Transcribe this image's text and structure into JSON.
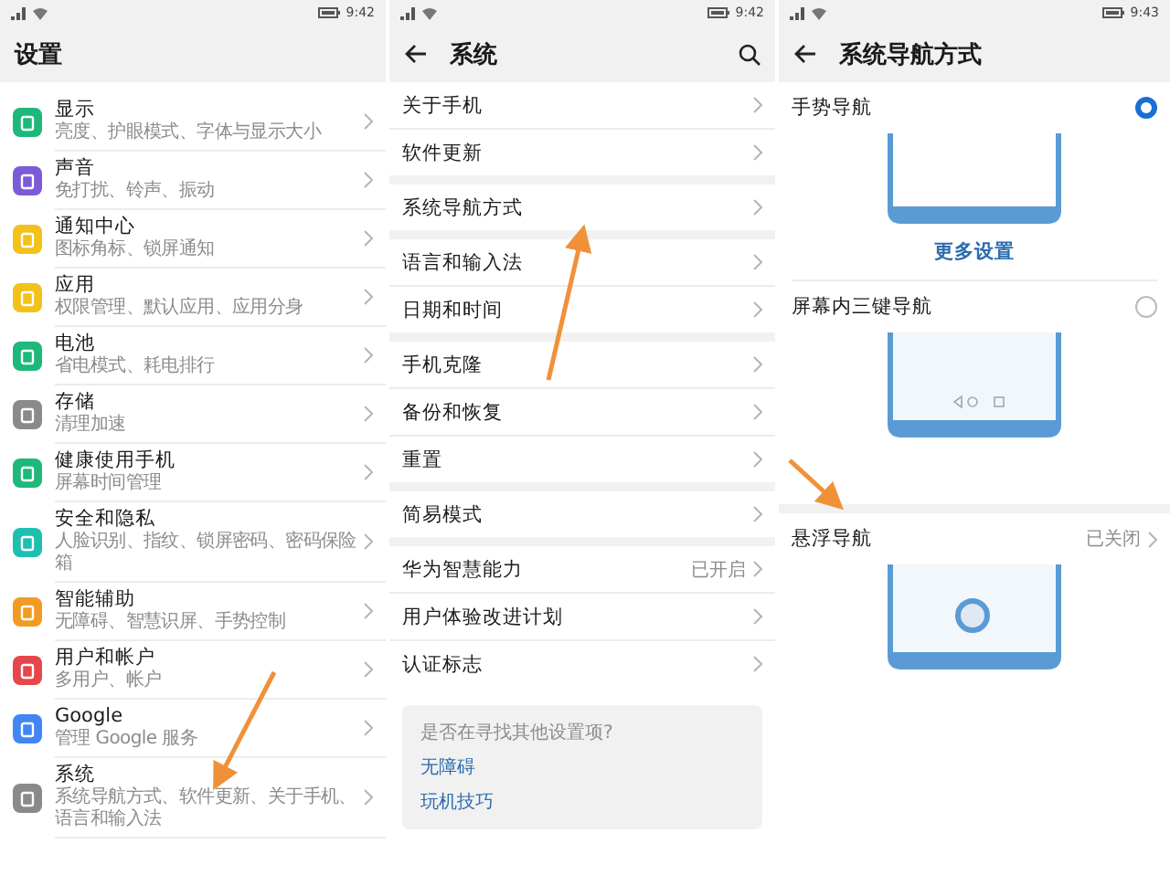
{
  "settings_screen": {
    "status_bar": {
      "time": "9:42"
    },
    "title": "设置",
    "items": [
      {
        "title": "显示",
        "subtitle": "亮度、护眼模式、字体与显示大小",
        "color": "#1db87a"
      },
      {
        "title": "声音",
        "subtitle": "免打扰、铃声、振动",
        "color": "#7b5cd6"
      },
      {
        "title": "通知中心",
        "subtitle": "图标角标、锁屏通知",
        "color": "#f2c21b"
      },
      {
        "title": "应用",
        "subtitle": "权限管理、默认应用、应用分身",
        "color": "#f2c21b"
      },
      {
        "title": "电池",
        "subtitle": "省电模式、耗电排行",
        "color": "#1db87a"
      },
      {
        "title": "存储",
        "subtitle": "清理加速",
        "color": "#8a8a8a"
      },
      {
        "title": "健康使用手机",
        "subtitle": "屏幕时间管理",
        "color": "#1db87a"
      },
      {
        "title": "安全和隐私",
        "subtitle": "人脸识别、指纹、锁屏密码、密码保险箱",
        "color": "#1fbfb0"
      },
      {
        "title": "智能辅助",
        "subtitle": "无障碍、智慧识屏、手势控制",
        "color": "#f29b24"
      },
      {
        "title": "用户和帐户",
        "subtitle": "多用户、帐户",
        "color": "#e5474b"
      },
      {
        "title": "Google",
        "subtitle": "管理 Google 服务",
        "color": "#4285f4"
      },
      {
        "title": "系统",
        "subtitle": "系统导航方式、软件更新、关于手机、语言和输入法",
        "color": "#8a8a8a"
      }
    ]
  },
  "system_screen": {
    "status_bar": {
      "time": "9:42"
    },
    "title": "系统",
    "groups": [
      [
        {
          "label": "关于手机"
        },
        {
          "label": "软件更新"
        }
      ],
      [
        {
          "label": "系统导航方式"
        }
      ],
      [
        {
          "label": "语言和输入法"
        },
        {
          "label": "日期和时间"
        }
      ],
      [
        {
          "label": "手机克隆"
        },
        {
          "label": "备份和恢复"
        },
        {
          "label": "重置"
        }
      ],
      [
        {
          "label": "简易模式"
        }
      ],
      [
        {
          "label": "华为智慧能力",
          "value": "已开启"
        },
        {
          "label": "用户体验改进计划"
        },
        {
          "label": "认证标志"
        }
      ]
    ],
    "suggestions": {
      "prompt": "是否在寻找其他设置项?",
      "links": [
        "无障碍",
        "玩机技巧"
      ]
    }
  },
  "navigation_screen": {
    "status_bar": {
      "time": "9:43"
    },
    "title": "系统导航方式",
    "options": [
      {
        "label": "手势导航",
        "selected": true,
        "kind": "gesture",
        "link": "更多设置"
      },
      {
        "label": "屏幕内三键导航",
        "selected": false,
        "kind": "three_key"
      }
    ],
    "floating": {
      "label": "悬浮导航",
      "status": "已关闭"
    }
  }
}
